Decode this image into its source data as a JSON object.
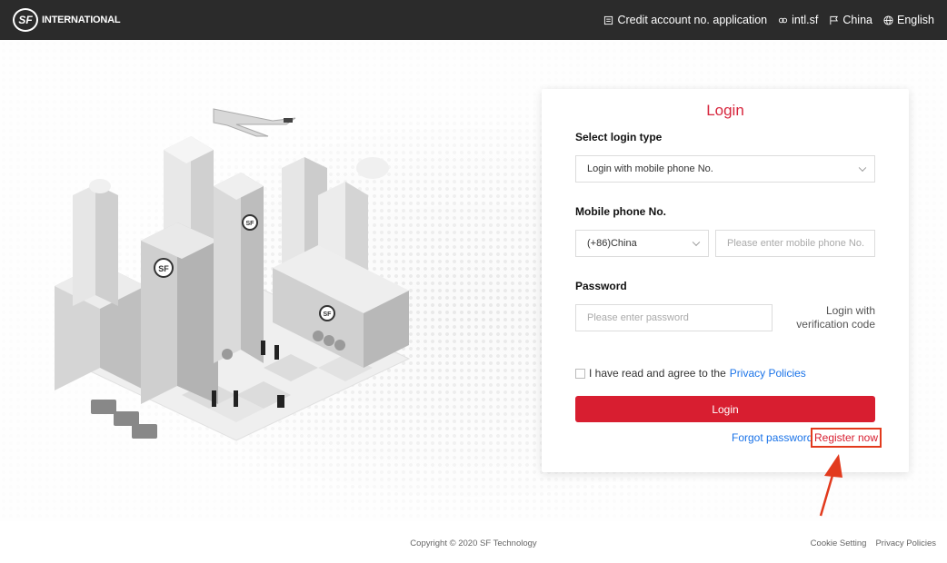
{
  "header": {
    "logo_mark": "SF",
    "logo_text": "INTERNATIONAL",
    "nav": {
      "credit": "Credit account no. application",
      "intl": "intl.sf",
      "region": "China",
      "language": "English"
    }
  },
  "login": {
    "title": "Login",
    "login_type_label": "Select login type",
    "login_type_value": "Login with mobile phone No.",
    "phone_label": "Mobile phone No.",
    "country_code": "(+86)China",
    "phone_placeholder": "Please enter mobile phone No.",
    "password_label": "Password",
    "password_placeholder": "Please enter password",
    "verification_line1": "Login with",
    "verification_line2": "verification code",
    "agree_text": "I have read and agree to the",
    "privacy_link": "Privacy Policies",
    "login_button": "Login",
    "forgot_password": "Forgot password",
    "register_now": "Register now"
  },
  "footer": {
    "copyright": "Copyright © 2020 SF Technology",
    "cookie_setting": "Cookie Setting",
    "privacy_policies": "Privacy Policies"
  },
  "colors": {
    "brand_red": "#d81e30",
    "link_blue": "#1a73e8",
    "header_bg": "#2b2b2b",
    "highlight": "#e23a1d"
  }
}
